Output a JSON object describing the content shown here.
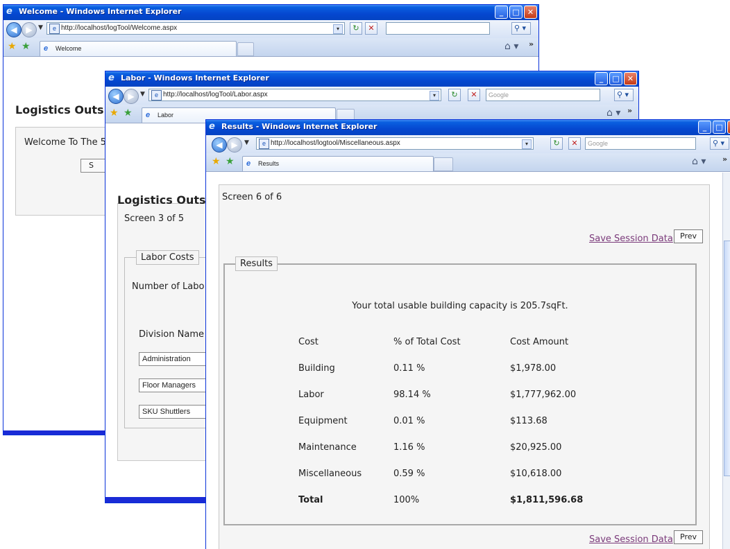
{
  "windows": {
    "welcome": {
      "title": "Welcome - Windows Internet Explorer",
      "url": "http://localhost/logTool/Welcome.aspx",
      "tab_label": "Welcome",
      "heading": "Logistics Outs",
      "welcome_text": "Welcome To The 5",
      "button_text": "S"
    },
    "labor": {
      "title": "Labor - Windows Internet Explorer",
      "url": "http://localhost/logTool/Labor.aspx",
      "search_placeholder": "Google",
      "tab_label": "Labor",
      "heading": "Logistics Outs",
      "screen_text": "Screen 3 of 5",
      "legend": "Labor Costs",
      "number_of_labor": "Number of Labo",
      "division_header": "Division Name",
      "divisions": [
        "Administration",
        "Floor Managers",
        "SKU Shuttlers"
      ]
    },
    "results": {
      "title": "Results - Windows Internet Explorer",
      "url": "http://localhost/logtool/Miscellaneous.aspx",
      "search_placeholder": "Google",
      "tab_label": "Results",
      "screen_text": "Screen 6 of 6",
      "save_link": "Save Session Data",
      "prev_button": "Prev",
      "legend": "Results",
      "capacity_text": "Your total usable building capacity is 205.7sqFt.",
      "table": {
        "headers": [
          "Cost",
          "% of Total Cost",
          "Cost Amount"
        ],
        "rows": [
          [
            "Building",
            "0.11 %",
            "$1,978.00"
          ],
          [
            "Labor",
            "98.14 %",
            "$1,777,962.00"
          ],
          [
            "Equipment",
            "0.01 %",
            "$113.68"
          ],
          [
            "Maintenance",
            "1.16 %",
            "$20,925.00"
          ],
          [
            "Miscellaneous",
            "0.59 %",
            "$10,618.00"
          ]
        ],
        "total": [
          "Total",
          "100%",
          "$1,811,596.68"
        ]
      }
    }
  },
  "icons": {
    "back": "back-arrow-icon",
    "forward": "forward-arrow-icon",
    "refresh": "refresh-icon",
    "stop": "stop-icon",
    "search": "search-icon",
    "favorites": "favorites-star-icon",
    "add_favorite": "add-favorite-icon",
    "home": "home-icon"
  },
  "colors": {
    "titlebar": "#0547d0",
    "link": "#7a3a7a",
    "window_bottom_bar": "#1a2bd6"
  }
}
